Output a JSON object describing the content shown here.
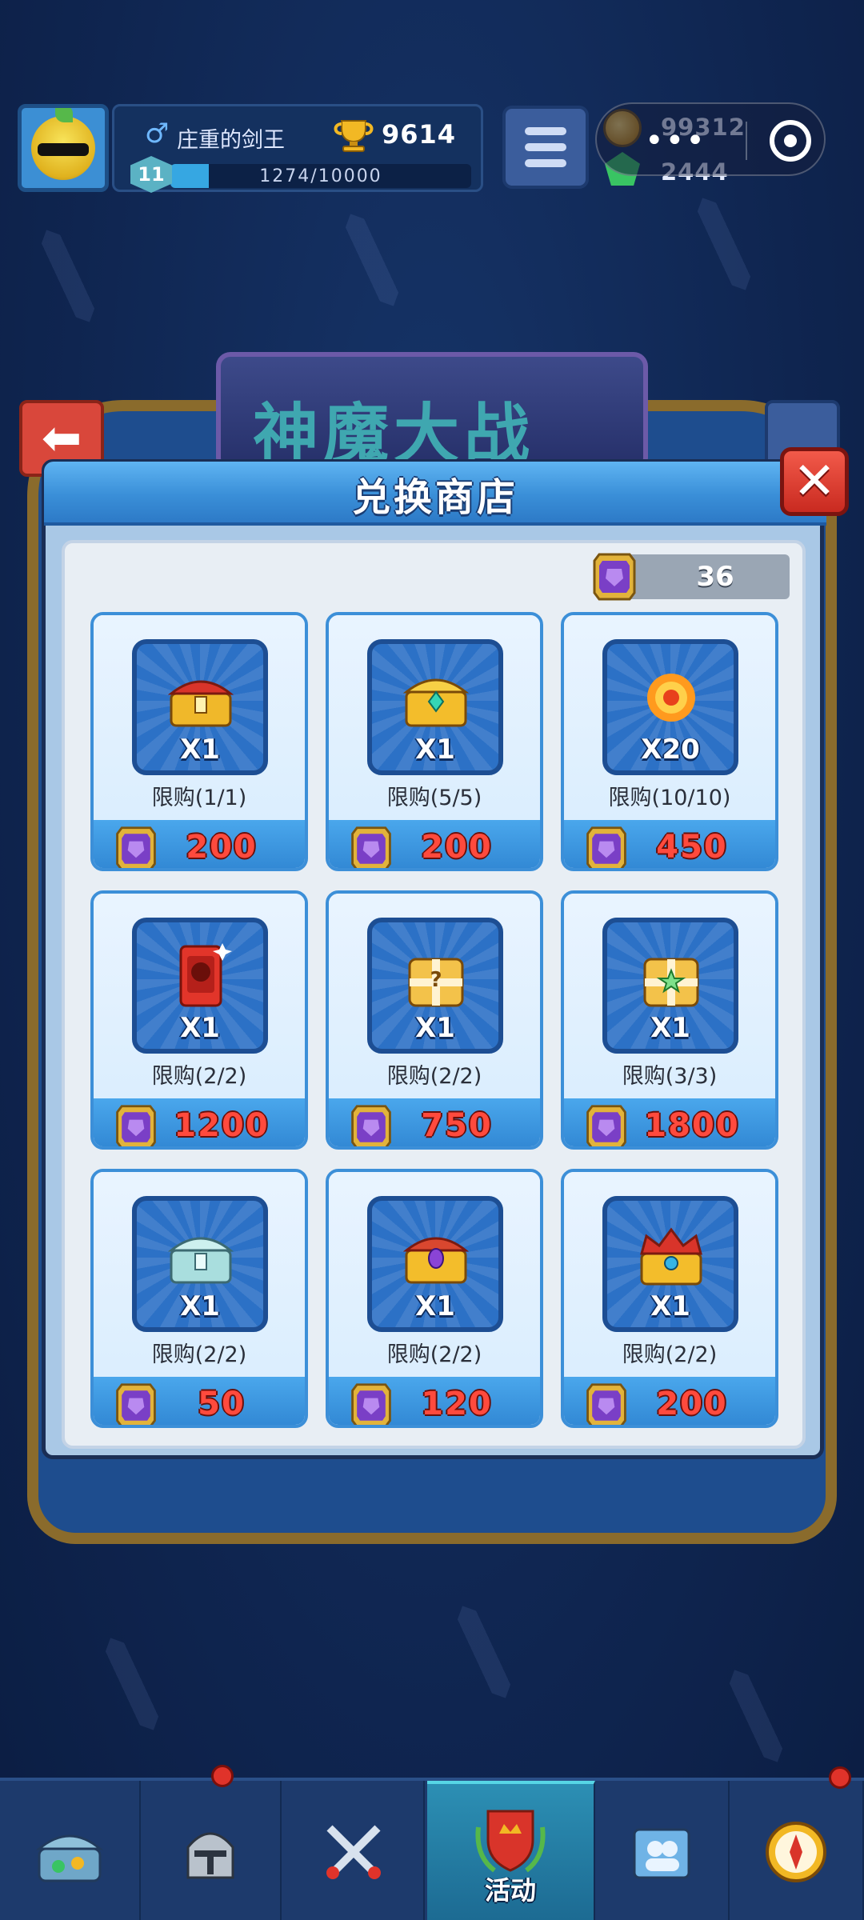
{
  "player": {
    "name": "庄重的剑王",
    "trophies": "9614",
    "level": "11",
    "xp": "1274/10000",
    "xp_fraction": 0.1274
  },
  "currency": {
    "coins": "99312",
    "gems": "2444"
  },
  "background": {
    "event_title": "神魔大战"
  },
  "shop": {
    "title": "兑换商店",
    "balance": "36",
    "items": [
      {
        "icon": "red-gold-chest-icon",
        "qty": "X1",
        "limit": "限购(1/1)",
        "price": "200"
      },
      {
        "icon": "golden-gem-chest-icon",
        "qty": "X1",
        "limit": "限购(5/5)",
        "price": "200"
      },
      {
        "icon": "fire-orb-icon",
        "qty": "X20",
        "limit": "限购(10/10)",
        "price": "450"
      },
      {
        "icon": "red-card-icon",
        "qty": "X1",
        "limit": "限购(2/2)",
        "price": "1200"
      },
      {
        "icon": "gold-mystery-box-icon",
        "qty": "X1",
        "limit": "限购(2/2)",
        "price": "750"
      },
      {
        "icon": "gold-star-box-icon",
        "qty": "X1",
        "limit": "限购(3/3)",
        "price": "1800"
      },
      {
        "icon": "silver-chest-icon",
        "qty": "X1",
        "limit": "限购(2/2)",
        "price": "50"
      },
      {
        "icon": "golden-purple-chest-icon",
        "qty": "X1",
        "limit": "限购(2/2)",
        "price": "120"
      },
      {
        "icon": "royal-crown-chest-icon",
        "qty": "X1",
        "limit": "限购(2/2)",
        "price": "200"
      }
    ]
  },
  "nav": {
    "tabs": [
      {
        "icon": "treasure-chest-icon",
        "label": ""
      },
      {
        "icon": "knight-helmet-icon",
        "label": ""
      },
      {
        "icon": "crossed-swords-icon",
        "label": ""
      },
      {
        "icon": "event-shield-icon",
        "label": "活动"
      },
      {
        "icon": "team-banner-icon",
        "label": ""
      },
      {
        "icon": "compass-icon",
        "label": ""
      }
    ]
  },
  "colors": {
    "background": "#0f2550",
    "card_border": "#3c8fd8",
    "price_text": "#ff4a3d",
    "close_button": "#d8372b"
  }
}
